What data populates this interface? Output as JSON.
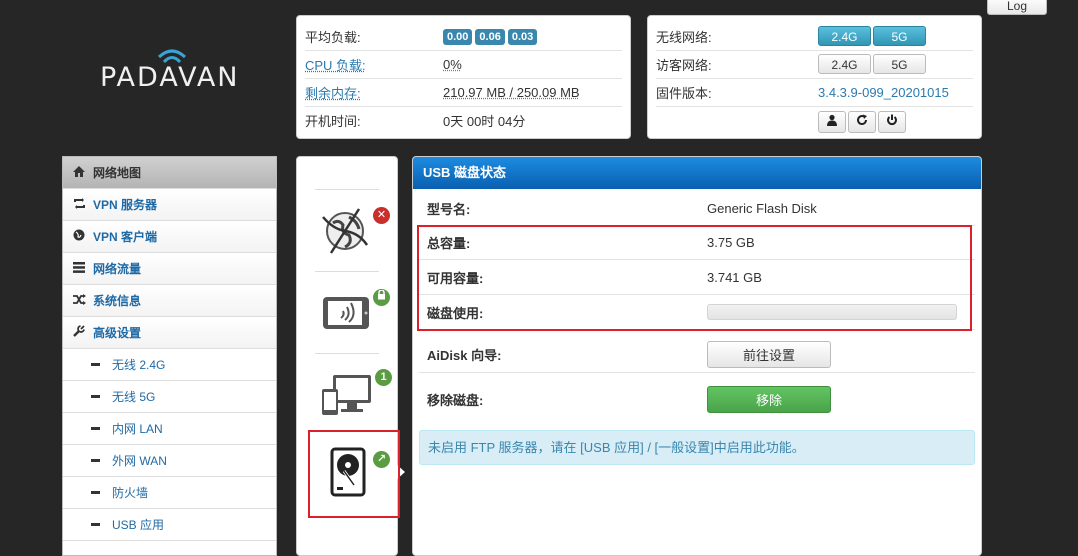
{
  "top_button": "Log",
  "logo": {
    "text": "PADAVAN"
  },
  "status_left": {
    "load_label": "平均负载:",
    "load_values": [
      "0.00",
      "0.06",
      "0.03"
    ],
    "cpu_label": "CPU 负载:",
    "cpu_value": "0%",
    "mem_label": "剩余内存:",
    "mem_value": "210.97 MB / 250.09 MB",
    "uptime_label": "开机时间:",
    "uptime_value": "0天 00时 04分"
  },
  "status_right": {
    "wireless_label": "无线网络:",
    "wireless_options": [
      "2.4G",
      "5G"
    ],
    "guest_label": "访客网络:",
    "guest_options": [
      "2.4G",
      "5G"
    ],
    "firmware_label": "固件版本:",
    "firmware_value": "3.4.3.9-099_20201015",
    "action_icons": [
      "user-icon",
      "refresh-icon",
      "power-icon"
    ]
  },
  "menu": {
    "items": [
      {
        "label": "网络地图",
        "icon": "home-icon"
      },
      {
        "label": "VPN 服务器",
        "icon": "retweet-icon"
      },
      {
        "label": "VPN 客户端",
        "icon": "globe-icon"
      },
      {
        "label": "网络流量",
        "icon": "list-icon"
      },
      {
        "label": "系统信息",
        "icon": "random-icon"
      },
      {
        "label": "高级设置",
        "icon": "wrench-icon"
      }
    ],
    "subitems": [
      "无线 2.4G",
      "无线 5G",
      "内网 LAN",
      "外网 WAN",
      "防火墙",
      "USB 应用"
    ]
  },
  "icon_badges": {
    "internet": "✕",
    "wireless": "🔒",
    "clients": "1",
    "usb": "↗"
  },
  "usb": {
    "title": "USB 磁盘状态",
    "model_label": "型号名:",
    "model_value": "Generic Flash Disk",
    "total_label": "总容量:",
    "total_value": "3.75 GB",
    "free_label": "可用容量:",
    "free_value": "3.741 GB",
    "usage_label": "磁盘使用:",
    "usage_fraction": 0.0,
    "aidisk_label": "AiDisk 向导:",
    "aidisk_button": "前往设置",
    "remove_label": "移除磁盘:",
    "remove_button": "移除",
    "info": "未启用 FTP 服务器，请在 [USB 应用] / [一般设置]中启用此功能。"
  },
  "colors": {
    "accent_blue": "#0a5fb0",
    "highlight_red": "#d9202c",
    "remove_green": "#4aa34a"
  }
}
